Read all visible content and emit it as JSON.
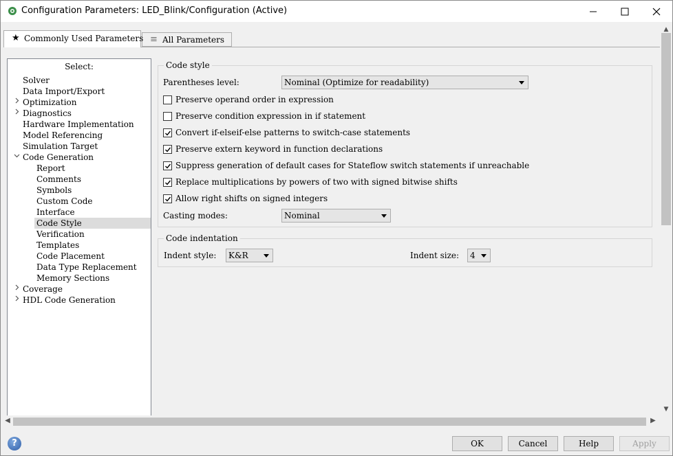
{
  "window": {
    "title": "Configuration Parameters: LED_Blink/Configuration (Active)"
  },
  "tabs": [
    {
      "label": "Commonly Used Parameters",
      "icon": "star-icon",
      "active": true
    },
    {
      "label": "All Parameters",
      "icon": "list-icon",
      "active": false
    }
  ],
  "tree": {
    "header": "Select:",
    "items": [
      {
        "label": "Solver",
        "level": 0,
        "expander": ""
      },
      {
        "label": "Data Import/Export",
        "level": 0,
        "expander": ""
      },
      {
        "label": "Optimization",
        "level": 0,
        "expander": ">"
      },
      {
        "label": "Diagnostics",
        "level": 0,
        "expander": ">"
      },
      {
        "label": "Hardware Implementation",
        "level": 0,
        "expander": ""
      },
      {
        "label": "Model Referencing",
        "level": 0,
        "expander": ""
      },
      {
        "label": "Simulation Target",
        "level": 0,
        "expander": ""
      },
      {
        "label": "Code Generation",
        "level": 0,
        "expander": "v"
      },
      {
        "label": "Report",
        "level": 1,
        "expander": ""
      },
      {
        "label": "Comments",
        "level": 1,
        "expander": ""
      },
      {
        "label": "Symbols",
        "level": 1,
        "expander": ""
      },
      {
        "label": "Custom Code",
        "level": 1,
        "expander": ""
      },
      {
        "label": "Interface",
        "level": 1,
        "expander": ""
      },
      {
        "label": "Code Style",
        "level": 1,
        "expander": "",
        "selected": true
      },
      {
        "label": "Verification",
        "level": 1,
        "expander": ""
      },
      {
        "label": "Templates",
        "level": 1,
        "expander": ""
      },
      {
        "label": "Code Placement",
        "level": 1,
        "expander": ""
      },
      {
        "label": "Data Type Replacement",
        "level": 1,
        "expander": ""
      },
      {
        "label": "Memory Sections",
        "level": 1,
        "expander": ""
      },
      {
        "label": "Coverage",
        "level": 0,
        "expander": ">"
      },
      {
        "label": "HDL Code Generation",
        "level": 0,
        "expander": ">"
      }
    ]
  },
  "code_style": {
    "group_title": "Code style",
    "parentheses_label": "Parentheses level:",
    "parentheses_value": "Nominal (Optimize for readability)",
    "checkboxes": [
      {
        "label": "Preserve operand order in expression",
        "checked": false
      },
      {
        "label": "Preserve condition expression in if statement",
        "checked": false
      },
      {
        "label": "Convert if-elseif-else patterns to switch-case statements",
        "checked": true
      },
      {
        "label": "Preserve extern keyword in function declarations",
        "checked": true
      },
      {
        "label": "Suppress generation of default cases for Stateflow switch statements if unreachable",
        "checked": true
      },
      {
        "label": "Replace multiplications by powers of two with signed bitwise shifts",
        "checked": true
      },
      {
        "label": "Allow right shifts on signed integers",
        "checked": true
      }
    ],
    "casting_label": "Casting modes:",
    "casting_value": "Nominal"
  },
  "code_indentation": {
    "group_title": "Code indentation",
    "indent_style_label": "Indent style:",
    "indent_style_value": "K&R",
    "indent_size_label": "Indent size:",
    "indent_size_value": "4"
  },
  "buttons": {
    "ok": "OK",
    "cancel": "Cancel",
    "help": "Help",
    "apply": "Apply"
  },
  "help_icon_glyph": "?"
}
